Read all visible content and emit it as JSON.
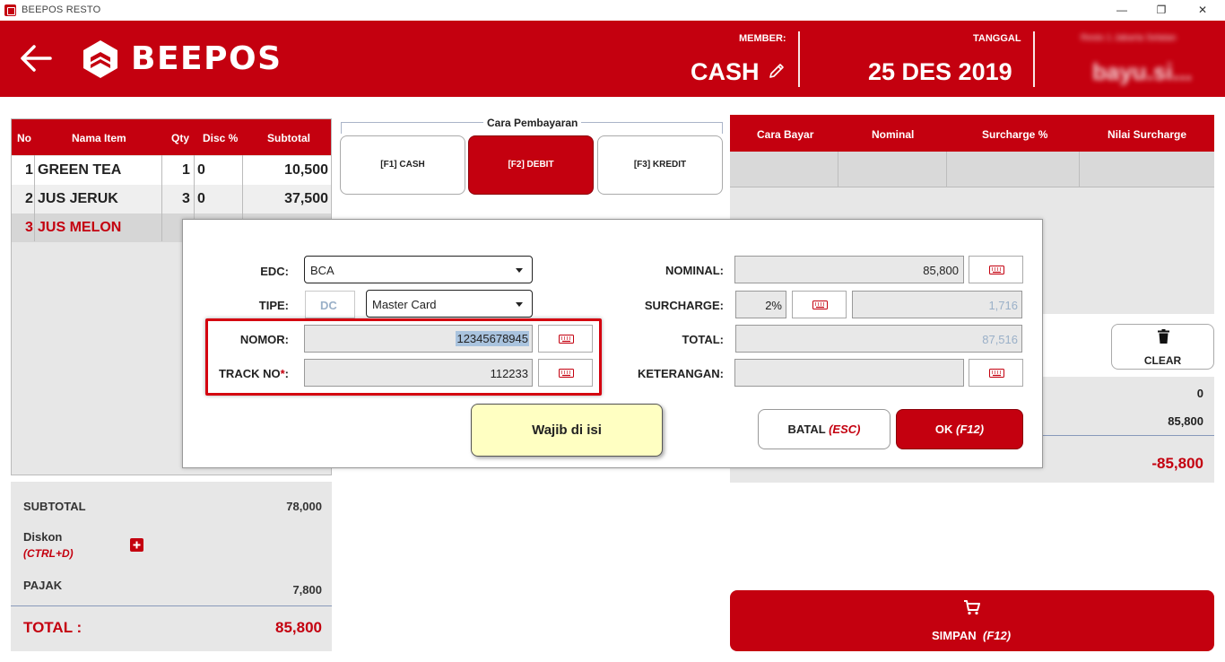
{
  "window": {
    "title": "BEEPOS RESTO",
    "minimize": "—",
    "restore": "❐",
    "close": "✕"
  },
  "header": {
    "logo_text": "BEEPOS",
    "member_label": "MEMBER:",
    "member_value": "CASH",
    "date_label": "TANGGAL",
    "date_value": "25 DES 2019",
    "user_label": "Resto 1 Jakarta Selatan",
    "user_value": "bayu.si..."
  },
  "items_table": {
    "headers": [
      "No",
      "Nama Item",
      "Qty",
      "Disc %",
      "Subtotal"
    ],
    "rows": [
      {
        "no": "1",
        "name": "GREEN TEA",
        "qty": "1",
        "disc": "0",
        "subtotal": "10,500"
      },
      {
        "no": "2",
        "name": "JUS JERUK",
        "qty": "3",
        "disc": "0",
        "subtotal": "37,500"
      },
      {
        "no": "3",
        "name": "JUS MELON",
        "qty": "",
        "disc": "",
        "subtotal": ""
      }
    ]
  },
  "summary": {
    "subtotal_label": "SUBTOTAL",
    "subtotal_value": "78,000",
    "diskon_label": "Diskon",
    "diskon_shortcut": "(CTRL+D)",
    "pajak_label": "PAJAK",
    "pajak_value": "7,800",
    "total_label": "TOTAL :",
    "total_value": "85,800"
  },
  "payment_method": {
    "title": "Cara Pembayaran",
    "options": [
      "[F1] CASH",
      "[F2] DEBIT",
      "[F3] KREDIT"
    ],
    "active": "[F2] DEBIT"
  },
  "payment_table": {
    "headers": [
      "Cara Bayar",
      "Nominal",
      "Surcharge %",
      "Nilai Surcharge"
    ]
  },
  "clear_button": "CLEAR",
  "right_summary": {
    "value1": "0",
    "value2": "85,800",
    "value3": "-85,800"
  },
  "simpan": {
    "label": "SIMPAN",
    "shortcut": "(F12)"
  },
  "modal": {
    "edc_label": "EDC:",
    "edc_value": "BCA",
    "tipe_label": "TIPE:",
    "tipe_code": "DC",
    "tipe_value": "Master Card",
    "nomor_label": "NOMOR:",
    "nomor_value": "12345678945",
    "track_label": "TRACK NO",
    "track_required": "*",
    "track_colon": ":",
    "track_value": "112233",
    "nominal_label": "NOMINAL:",
    "nominal_value": "85,800",
    "surcharge_label": "SURCHARGE:",
    "surcharge_pct": "2%",
    "surcharge_value": "1,716",
    "total_label": "TOTAL:",
    "total_value": "87,516",
    "keterangan_label": "KETERANGAN:",
    "keterangan_value": "",
    "tooltip": "Wajib di isi",
    "batal_label": "BATAL",
    "batal_shortcut": "(ESC)",
    "ok_label": "OK",
    "ok_shortcut": "(F12)"
  },
  "colors": {
    "brand_red": "#c4000f",
    "panel_gray": "#e7e7e7",
    "tooltip_yellow": "#ffffc2",
    "muted_blue": "#9ab0c8"
  }
}
